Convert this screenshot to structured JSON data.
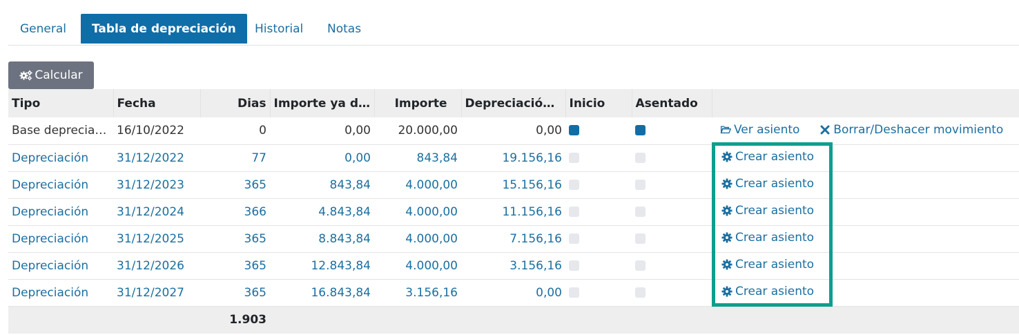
{
  "tabs": [
    {
      "label": "General"
    },
    {
      "label": "Tabla de depreciación"
    },
    {
      "label": "Historial"
    },
    {
      "label": "Notas"
    }
  ],
  "toolbar": {
    "calculate_label": "Calcular"
  },
  "table": {
    "headers": [
      "Tipo",
      "Fecha",
      "Dias",
      "Importe ya de…",
      "Importe",
      "Depreciación …",
      "Inicio",
      "Asentado",
      ""
    ],
    "base_row": {
      "tipo": "Base depreciac…",
      "fecha": "16/10/2022",
      "dias": "0",
      "importe_ya": "0,00",
      "importe": "20.000,00",
      "depreciacion": "0,00",
      "inicio": true,
      "asentado": true,
      "view_label": "Ver asiento",
      "undo_label": "Borrar/Deshacer movimiento"
    },
    "rows": [
      {
        "tipo": "Depreciación",
        "fecha": "31/12/2022",
        "dias": "77",
        "importe_ya": "0,00",
        "importe": "843,84",
        "depreciacion": "19.156,16",
        "inicio": false,
        "asentado": false,
        "action": "Crear asiento"
      },
      {
        "tipo": "Depreciación",
        "fecha": "31/12/2023",
        "dias": "365",
        "importe_ya": "843,84",
        "importe": "4.000,00",
        "depreciacion": "15.156,16",
        "inicio": false,
        "asentado": false,
        "action": "Crear asiento"
      },
      {
        "tipo": "Depreciación",
        "fecha": "31/12/2024",
        "dias": "366",
        "importe_ya": "4.843,84",
        "importe": "4.000,00",
        "depreciacion": "11.156,16",
        "inicio": false,
        "asentado": false,
        "action": "Crear asiento"
      },
      {
        "tipo": "Depreciación",
        "fecha": "31/12/2025",
        "dias": "365",
        "importe_ya": "8.843,84",
        "importe": "4.000,00",
        "depreciacion": "7.156,16",
        "inicio": false,
        "asentado": false,
        "action": "Crear asiento"
      },
      {
        "tipo": "Depreciación",
        "fecha": "31/12/2026",
        "dias": "365",
        "importe_ya": "12.843,84",
        "importe": "4.000,00",
        "depreciacion": "3.156,16",
        "inicio": false,
        "asentado": false,
        "action": "Crear asiento"
      },
      {
        "tipo": "Depreciación",
        "fecha": "31/12/2027",
        "dias": "365",
        "importe_ya": "16.843,84",
        "importe": "3.156,16",
        "depreciacion": "0,00",
        "inicio": false,
        "asentado": false,
        "action": "Crear asiento"
      }
    ],
    "footer": {
      "dias_total": "1.903"
    }
  },
  "icons": {
    "calculate": "gears-icon",
    "view": "folder-open-icon",
    "undo": "times-icon",
    "create": "gear-icon"
  },
  "colors": {
    "primary": "#0f6ea8",
    "link": "#1b6fa0",
    "button_gray": "#6c727f",
    "highlight": "#0e9e8e"
  }
}
